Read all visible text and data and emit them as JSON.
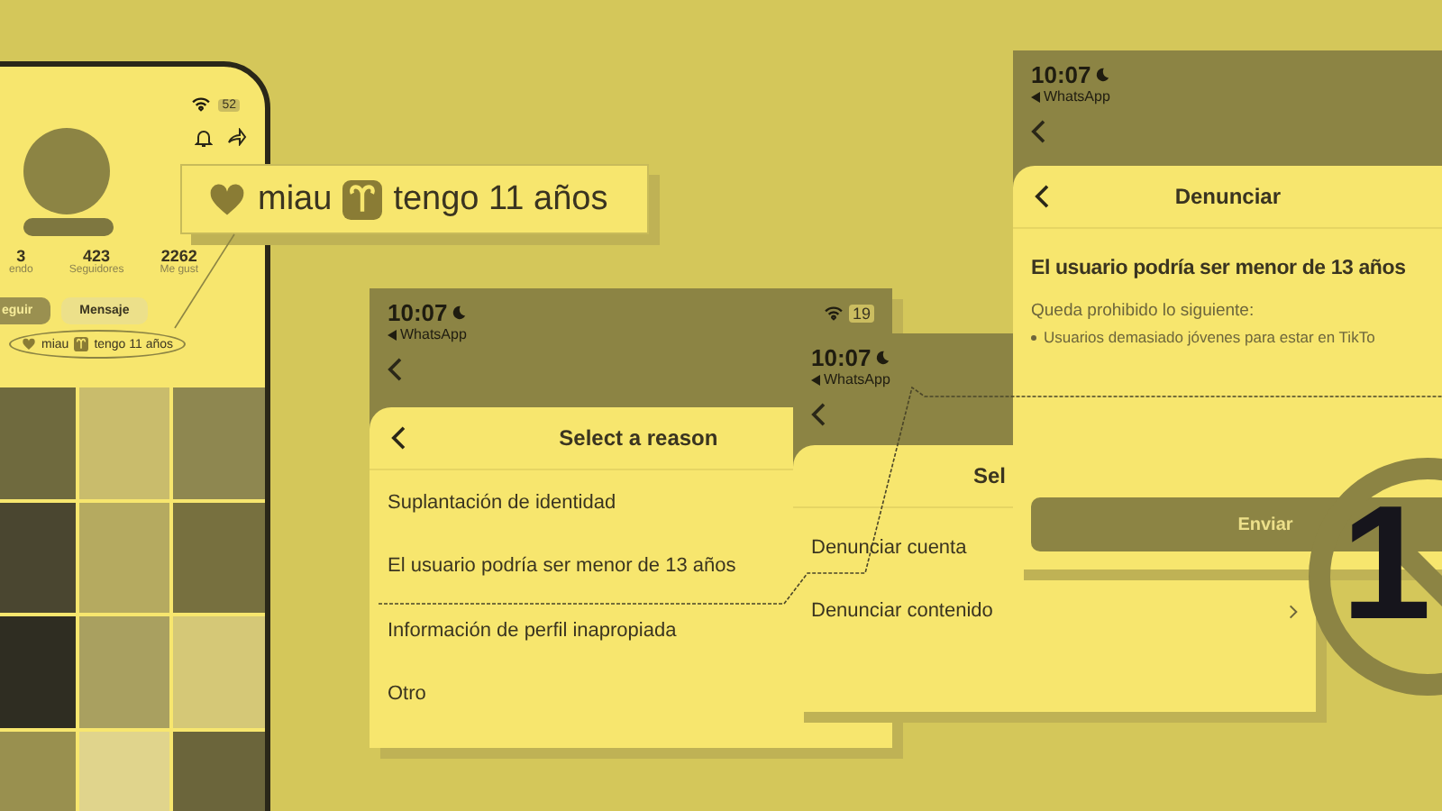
{
  "phone": {
    "battery": "52",
    "stats": [
      {
        "value": "3",
        "label": "endo"
      },
      {
        "value": "423",
        "label": "Seguidores"
      },
      {
        "value": "2262",
        "label": "Me gust"
      }
    ],
    "buttons": [
      {
        "label": "eguir",
        "kind": "primary"
      },
      {
        "label": "Mensaje",
        "kind": "secondary"
      }
    ],
    "bio": {
      "word": "miau",
      "text": "tengo 11 años"
    }
  },
  "callout": {
    "word": "miau",
    "text": "tengo 11 años"
  },
  "screens": [
    {
      "time": "10:07",
      "back_app": "WhatsApp",
      "battery": "19",
      "title": "Select a reason",
      "items": [
        {
          "label": "Suplantación de identidad",
          "kind": "plain"
        },
        {
          "label": "El usuario podría ser menor de 13 años",
          "kind": "plain"
        },
        {
          "label": "Información de perfil inapropiada",
          "kind": "plain"
        },
        {
          "label": "Otro",
          "kind": "plain"
        }
      ]
    },
    {
      "time": "10:07",
      "back_app": "WhatsApp",
      "title": "Sel",
      "items": [
        {
          "label": "Denunciar cuenta",
          "kind": "plain"
        },
        {
          "label": "Denunciar contenido",
          "kind": "link"
        }
      ]
    },
    {
      "time": "10:07",
      "back_app": "WhatsApp",
      "title": "Denunciar",
      "heading": "El usuario podría ser menor de 13 años",
      "subtitle": "Queda prohibido lo siguiente:",
      "bullet": "Usuarios demasiado jóvenes para estar en TikTo",
      "button": "Enviar"
    }
  ],
  "badge": {
    "number": "1"
  }
}
